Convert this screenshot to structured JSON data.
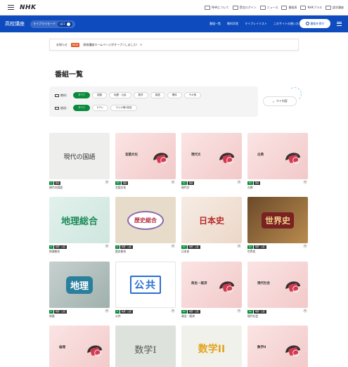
{
  "header": {
    "logo": "NHK",
    "top_links": [
      "NHKについて",
      "受信ログイン",
      "ニュース",
      "番組表",
      "NHKプラス",
      "語学講座"
    ]
  },
  "navbar": {
    "brand": "高校講座",
    "library_mode_label": "ライブラリモード",
    "library_mode_state": "OFF",
    "links": [
      "番組一覧",
      "教科学習",
      "マイプレイリスト",
      "このサイトの使い方"
    ],
    "search_label": "番組を探す"
  },
  "notice": {
    "label": "お知らせ",
    "badge": "NEW",
    "text": "高校講座ホームページがオープンしました！ >"
  },
  "page_title": "番組一覧",
  "filters": {
    "subject_label": "教科：",
    "subjects": [
      {
        "label": "すべて",
        "active": true
      },
      {
        "label": "国語",
        "active": false
      },
      {
        "label": "地歴・公民",
        "active": false
      },
      {
        "label": "数学",
        "active": false
      },
      {
        "label": "英語",
        "active": false
      },
      {
        "label": "理科",
        "active": false
      },
      {
        "label": "その他",
        "active": false
      }
    ],
    "channel_label": "放送：",
    "channels": [
      {
        "label": "すべて",
        "active": true
      },
      {
        "label": "Eテレ",
        "active": false
      },
      {
        "label": "ラジオ第2放送",
        "active": false
      }
    ]
  },
  "mylist_label": "マイ内容",
  "programs": [
    {
      "name": "現代の国語",
      "thumb": "現代の国語",
      "tags": [
        "E",
        "国語"
      ],
      "style": "sketch"
    },
    {
      "name": "言語文化",
      "thumb": "言語文化",
      "tags": [
        "R2",
        "国語"
      ],
      "style": "pink"
    },
    {
      "name": "現代文",
      "thumb": "現代文",
      "tags": [
        "R2",
        "国語"
      ],
      "style": "pink"
    },
    {
      "name": "古典",
      "thumb": "古典",
      "tags": [
        "R2",
        "国語"
      ],
      "style": "pink"
    },
    {
      "name": "地理総合",
      "thumb": "地理総合",
      "tags": [
        "E",
        "地歴・公民"
      ],
      "style": "map"
    },
    {
      "name": "歴史総合",
      "thumb": "歴史総合",
      "tags": [
        "E",
        "地歴・公民"
      ],
      "style": "history"
    },
    {
      "name": "日本史",
      "thumb": "日本史",
      "tags": [
        "R2",
        "地歴・公民"
      ],
      "style": "japan"
    },
    {
      "name": "世界史",
      "thumb": "世界史",
      "tags": [
        "R2",
        "地歴・公民"
      ],
      "style": "world"
    },
    {
      "name": "地理",
      "thumb": "地理",
      "tags": [
        "E",
        "地歴・公民"
      ],
      "style": "geo"
    },
    {
      "name": "公共",
      "thumb": "公共",
      "tags": [
        "E",
        "地歴・公民"
      ],
      "style": "public"
    },
    {
      "name": "政治・経済",
      "thumb": "政治・経済",
      "tags": [
        "R2",
        "地歴・公民"
      ],
      "style": "pink"
    },
    {
      "name": "現代社会",
      "thumb": "現代社会",
      "tags": [
        "R2",
        "地歴・公民"
      ],
      "style": "pink"
    },
    {
      "name": "倫理",
      "thumb": "倫理",
      "tags": [],
      "style": "pink"
    },
    {
      "name": "数学I",
      "thumb": "数学I",
      "tags": [],
      "style": "mathgray"
    },
    {
      "name": "数学II",
      "thumb": "数学II",
      "tags": [],
      "style": "mathyellow"
    },
    {
      "name": "数学II",
      "thumb": "数学II",
      "tags": [],
      "style": "pink"
    }
  ],
  "colors": {
    "nav": "#0d4bbe",
    "active_chip": "#0a8a3c",
    "notice_badge": "#e85a26"
  }
}
